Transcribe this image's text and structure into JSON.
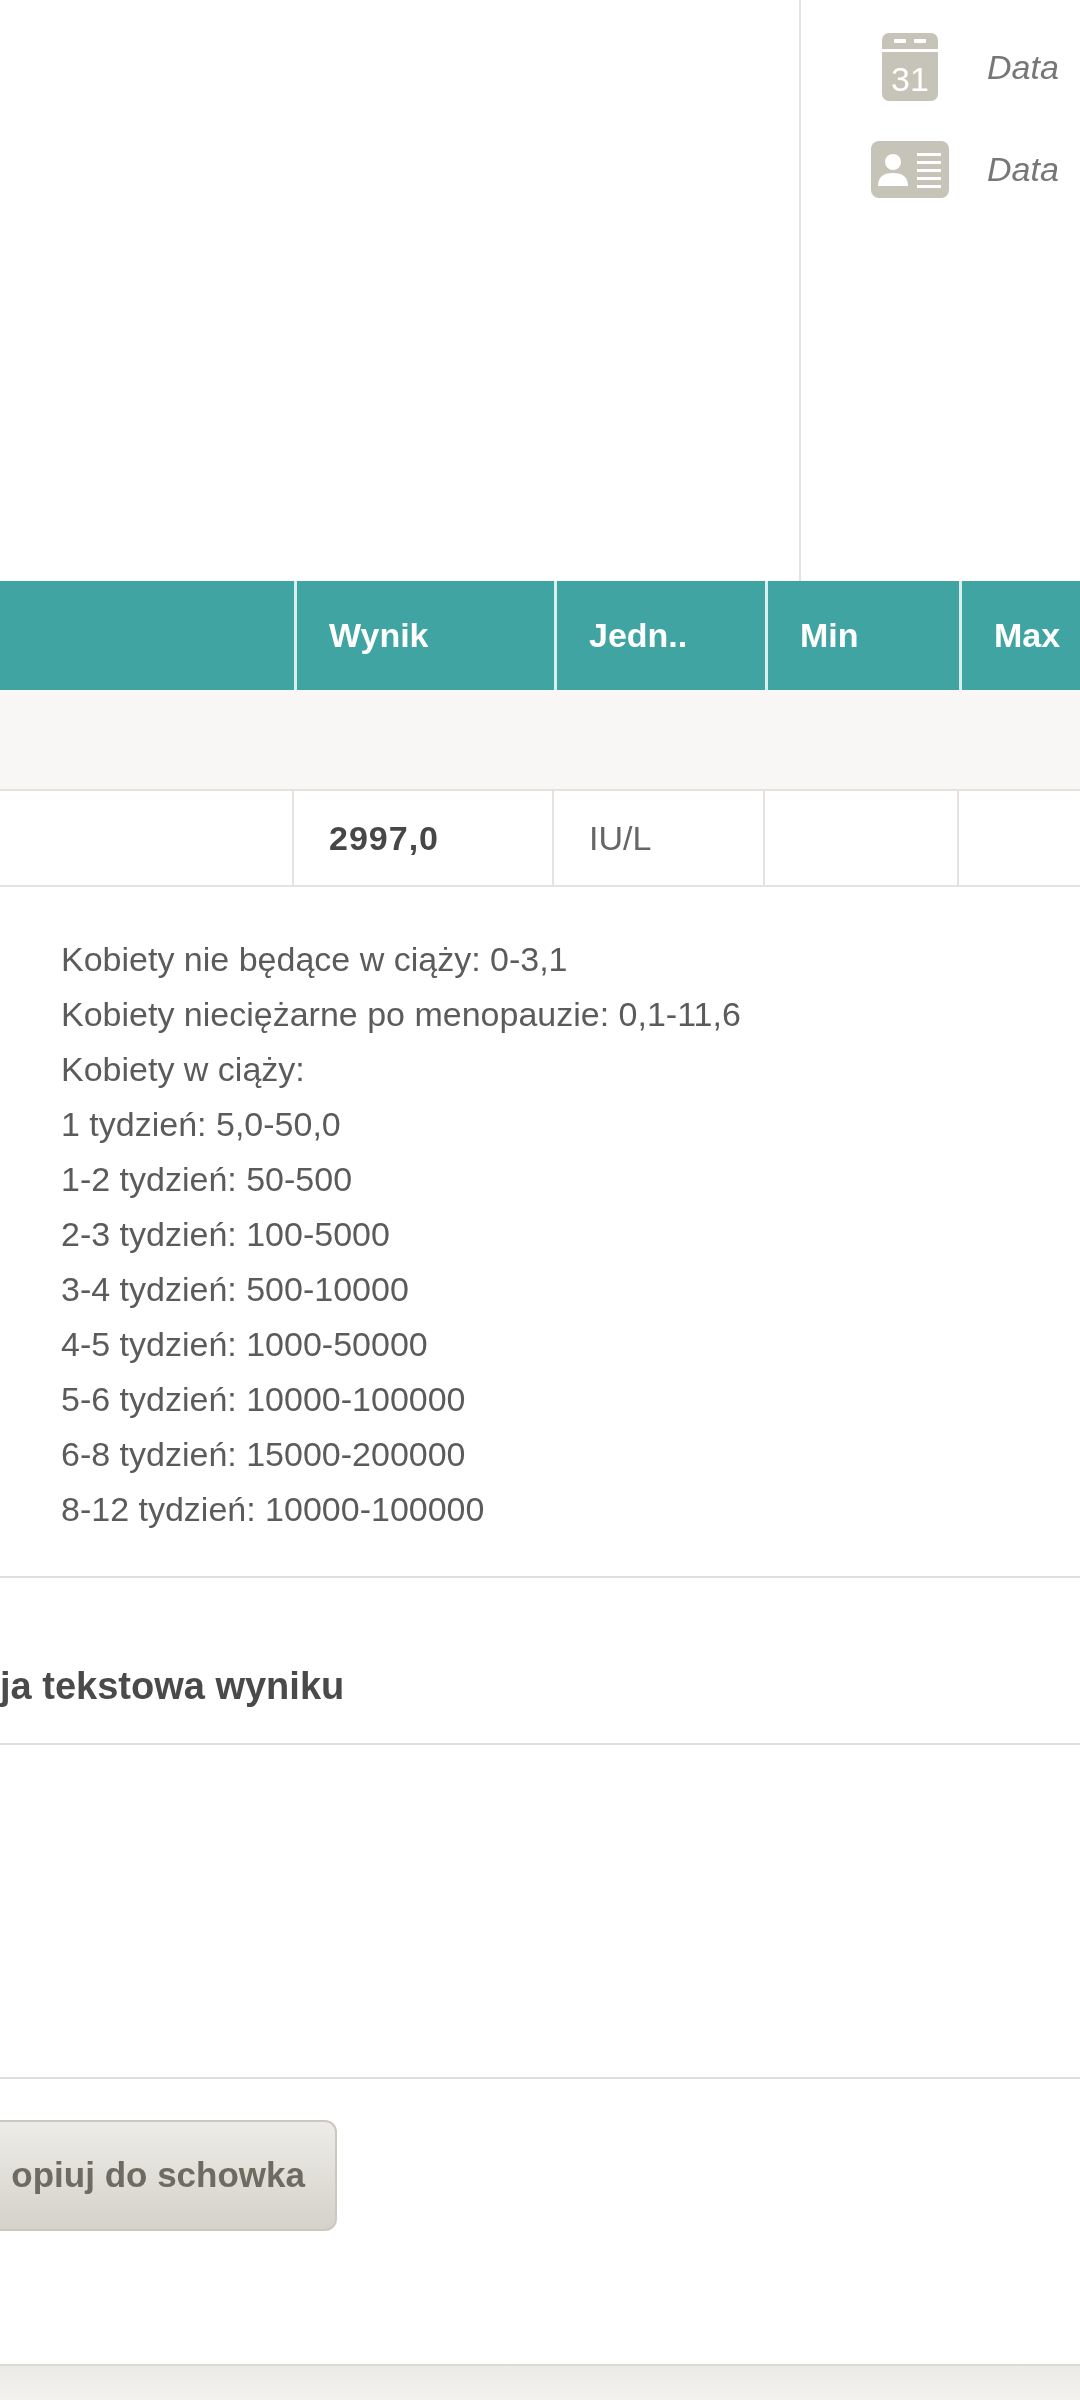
{
  "info_panel": {
    "items": [
      {
        "kind": "date",
        "icon_text": "31",
        "label": "Data"
      },
      {
        "kind": "person_card",
        "label": "Data"
      }
    ]
  },
  "results_table": {
    "columns": [
      "Wynik",
      "Jedn..",
      "Min",
      "Max"
    ],
    "rows": [
      {
        "kind": "group"
      },
      {
        "kind": "result",
        "value": "2997,0",
        "unit": "IU/L"
      }
    ]
  },
  "reference_range": {
    "lines": [
      "Kobiety nie będące w ciąży: 0-3,1",
      "Kobiety nieciężarne po menopauzie: 0,1-11,6",
      "Kobiety w ciąży:",
      "1 tydzień: 5,0-50,0",
      "1-2 tydzień: 50-500",
      "2-3 tydzień: 100-5000",
      "3-4 tydzień: 500-10000",
      "4-5 tydzień: 1000-50000",
      "5-6 tydzień: 10000-100000",
      "6-8 tydzień: 15000-200000",
      "8-12 tydzień: 10000-100000"
    ]
  },
  "text_interpretation": {
    "heading": "ja tekstowa wyniku"
  },
  "copy_button": {
    "label": "opiuj do schowka"
  }
}
